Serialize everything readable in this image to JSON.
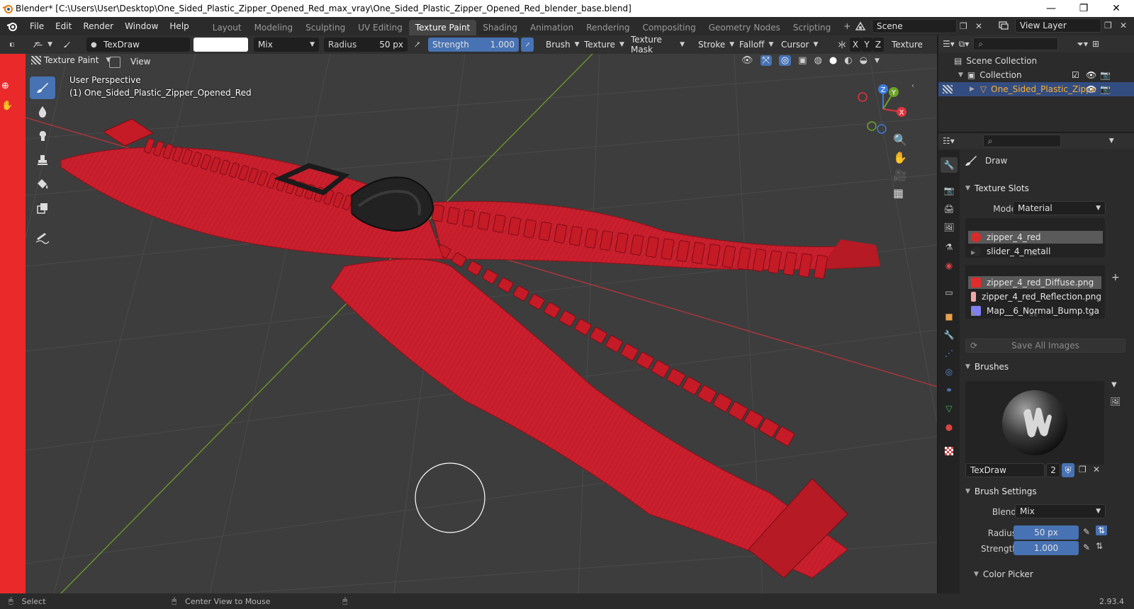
{
  "titlebar": {
    "title": "Blender* [C:\\Users\\User\\Desktop\\One_Sided_Plastic_Zipper_Opened_Red_max_vray\\One_Sided_Plastic_Zipper_Opened_Red_blender_base.blend]",
    "minimize": "—",
    "maximize": "❐",
    "close": "✕"
  },
  "menu": [
    "File",
    "Edit",
    "Render",
    "Window",
    "Help"
  ],
  "workspaces": [
    {
      "label": "Layout",
      "active": false
    },
    {
      "label": "Modeling",
      "active": false
    },
    {
      "label": "Sculpting",
      "active": false
    },
    {
      "label": "UV Editing",
      "active": false
    },
    {
      "label": "Texture Paint",
      "active": true
    },
    {
      "label": "Shading",
      "active": false
    },
    {
      "label": "Animation",
      "active": false
    },
    {
      "label": "Rendering",
      "active": false
    },
    {
      "label": "Compositing",
      "active": false
    },
    {
      "label": "Geometry Nodes",
      "active": false
    },
    {
      "label": "Scripting",
      "active": false
    }
  ],
  "add_workspace": "+",
  "scene": {
    "label": "Scene"
  },
  "view_layer": {
    "label": "View Layer"
  },
  "toolheader": {
    "brush_name": "TexDraw",
    "blend_mode": "Mix",
    "radius_label": "Radius",
    "radius_value": "50 px",
    "strength_label": "Strength",
    "strength_value": "1.000",
    "menus": [
      "Brush",
      "Texture",
      "Texture Mask",
      "Stroke",
      "Falloff",
      "Cursor"
    ],
    "axes": [
      "X",
      "Y",
      "Z"
    ],
    "texture_label": "Texture"
  },
  "viewport": {
    "mode": "Texture Paint",
    "view_menu": "View",
    "perspective": "User Perspective",
    "object_label": "(1) One_Sided_Plastic_Zipper_Opened_Red",
    "gizmo": {
      "x": "X",
      "y": "Y",
      "z": "Z"
    }
  },
  "outliner": {
    "scene_collection": "Scene Collection",
    "collection": "Collection",
    "object": "One_Sided_Plastic_Zippe"
  },
  "properties": {
    "tool_name": "Draw",
    "texture_slots": {
      "header": "Texture Slots",
      "mode_label": "Mode",
      "mode_value": "Material",
      "materials": [
        {
          "name": "zipper_4_red",
          "color": "#d92b2b"
        },
        {
          "name": "slider_4_metall",
          "color": "#2a2a2a"
        }
      ],
      "images": [
        {
          "name": "zipper_4_red_Diffuse.png",
          "color": "#e22b2b"
        },
        {
          "name": "zipper_4_red_Reflection.png",
          "color": "#f0a8a8"
        },
        {
          "name": "Map__6_Normal_Bump.tga",
          "color": "#8080f0"
        }
      ],
      "save_all": "Save All Images"
    },
    "brushes": {
      "header": "Brushes",
      "brush_name": "TexDraw",
      "users": "2"
    },
    "brush_settings": {
      "header": "Brush Settings",
      "blend_label": "Blend",
      "blend_value": "Mix",
      "radius_label": "Radius",
      "radius_value": "50 px",
      "strength_label": "Strength",
      "strength_value": "1.000",
      "color_picker": "Color Picker"
    }
  },
  "statusbar": {
    "select": "Select",
    "center_view": "Center View to Mouse",
    "version": "2.93.4"
  },
  "colors": {
    "accent_blue": "#4772b3",
    "zipper_red": "#c91d2a",
    "slider_black": "#202020"
  }
}
